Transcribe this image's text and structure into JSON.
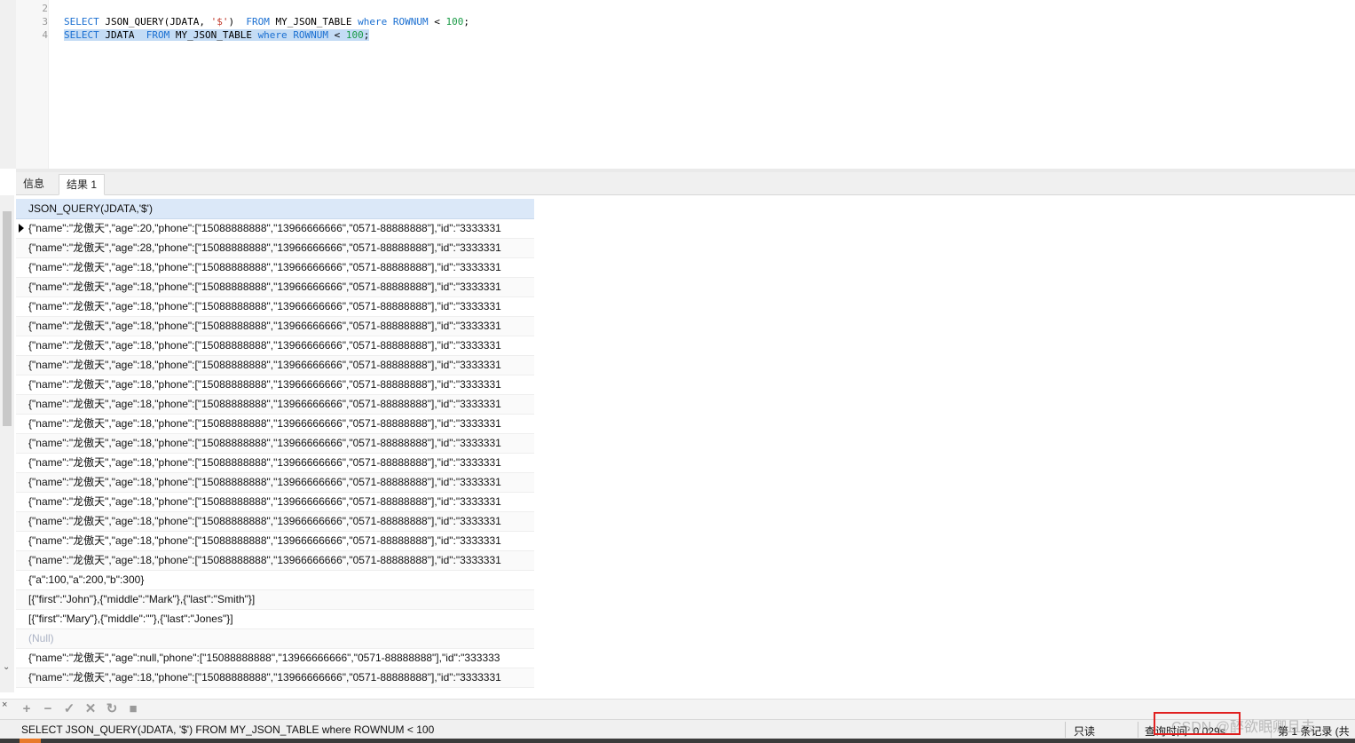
{
  "editor": {
    "lines": [
      {
        "num": "2"
      },
      {
        "num": "3",
        "tokens": [
          {
            "t": "kw",
            "v": "SELECT "
          },
          {
            "t": "plain",
            "v": "JSON_QUERY(JDATA, "
          },
          {
            "t": "str",
            "v": "'$'"
          },
          {
            "t": "plain",
            "v": ")  "
          },
          {
            "t": "kw",
            "v": "FROM "
          },
          {
            "t": "plain",
            "v": "MY_JSON_TABLE "
          },
          {
            "t": "kw",
            "v": "where "
          },
          {
            "t": "kw",
            "v": "ROWNUM "
          },
          {
            "t": "plain",
            "v": "< "
          },
          {
            "t": "num",
            "v": "100"
          },
          {
            "t": "plain",
            "v": ";"
          }
        ]
      },
      {
        "num": "4",
        "selected": true,
        "tokens": [
          {
            "t": "kw",
            "v": "SELECT "
          },
          {
            "t": "plain",
            "v": "JDATA  "
          },
          {
            "t": "kw",
            "v": "FROM "
          },
          {
            "t": "plain",
            "v": "MY_JSON_TABLE "
          },
          {
            "t": "kw",
            "v": "where "
          },
          {
            "t": "kw",
            "v": "ROWNUM "
          },
          {
            "t": "plain",
            "v": "< "
          },
          {
            "t": "num",
            "v": "100"
          },
          {
            "t": "plain",
            "v": ";"
          }
        ]
      }
    ]
  },
  "tabs": {
    "info": "信息",
    "result": "结果 1"
  },
  "grid": {
    "column": "JSON_QUERY(JDATA,'$')",
    "rows": [
      "{\"name\":\"龙傲天\",\"age\":20,\"phone\":[\"15088888888\",\"13966666666\",\"0571-88888888\"],\"id\":\"3333331",
      "{\"name\":\"龙傲天\",\"age\":28,\"phone\":[\"15088888888\",\"13966666666\",\"0571-88888888\"],\"id\":\"3333331",
      "{\"name\":\"龙傲天\",\"age\":18,\"phone\":[\"15088888888\",\"13966666666\",\"0571-88888888\"],\"id\":\"3333331",
      "{\"name\":\"龙傲天\",\"age\":18,\"phone\":[\"15088888888\",\"13966666666\",\"0571-88888888\"],\"id\":\"3333331",
      "{\"name\":\"龙傲天\",\"age\":18,\"phone\":[\"15088888888\",\"13966666666\",\"0571-88888888\"],\"id\":\"3333331",
      "{\"name\":\"龙傲天\",\"age\":18,\"phone\":[\"15088888888\",\"13966666666\",\"0571-88888888\"],\"id\":\"3333331",
      "{\"name\":\"龙傲天\",\"age\":18,\"phone\":[\"15088888888\",\"13966666666\",\"0571-88888888\"],\"id\":\"3333331",
      "{\"name\":\"龙傲天\",\"age\":18,\"phone\":[\"15088888888\",\"13966666666\",\"0571-88888888\"],\"id\":\"3333331",
      "{\"name\":\"龙傲天\",\"age\":18,\"phone\":[\"15088888888\",\"13966666666\",\"0571-88888888\"],\"id\":\"3333331",
      "{\"name\":\"龙傲天\",\"age\":18,\"phone\":[\"15088888888\",\"13966666666\",\"0571-88888888\"],\"id\":\"3333331",
      "{\"name\":\"龙傲天\",\"age\":18,\"phone\":[\"15088888888\",\"13966666666\",\"0571-88888888\"],\"id\":\"3333331",
      "{\"name\":\"龙傲天\",\"age\":18,\"phone\":[\"15088888888\",\"13966666666\",\"0571-88888888\"],\"id\":\"3333331",
      "{\"name\":\"龙傲天\",\"age\":18,\"phone\":[\"15088888888\",\"13966666666\",\"0571-88888888\"],\"id\":\"3333331",
      "{\"name\":\"龙傲天\",\"age\":18,\"phone\":[\"15088888888\",\"13966666666\",\"0571-88888888\"],\"id\":\"3333331",
      "{\"name\":\"龙傲天\",\"age\":18,\"phone\":[\"15088888888\",\"13966666666\",\"0571-88888888\"],\"id\":\"3333331",
      "{\"name\":\"龙傲天\",\"age\":18,\"phone\":[\"15088888888\",\"13966666666\",\"0571-88888888\"],\"id\":\"3333331",
      "{\"name\":\"龙傲天\",\"age\":18,\"phone\":[\"15088888888\",\"13966666666\",\"0571-88888888\"],\"id\":\"3333331",
      "{\"name\":\"龙傲天\",\"age\":18,\"phone\":[\"15088888888\",\"13966666666\",\"0571-88888888\"],\"id\":\"3333331",
      "{\"a\":100,\"a\":200,\"b\":300}",
      "[{\"first\":\"John\"},{\"middle\":\"Mark\"},{\"last\":\"Smith\"}]",
      "[{\"first\":\"Mary\"},{\"middle\":\"\"},{\"last\":\"Jones\"}]",
      "(Null)",
      "{\"name\":\"龙傲天\",\"age\":null,\"phone\":[\"15088888888\",\"13966666666\",\"0571-88888888\"],\"id\":\"333333",
      "{\"name\":\"龙傲天\",\"age\":18,\"phone\":[\"15088888888\",\"13966666666\",\"0571-88888888\"],\"id\":\"3333331"
    ],
    "selected_row": 0,
    "null_value": "(Null)"
  },
  "toolbar": {
    "buttons": [
      {
        "name": "add-row-button",
        "glyph": "+"
      },
      {
        "name": "delete-row-button",
        "glyph": "−"
      },
      {
        "name": "apply-button",
        "glyph": "✓"
      },
      {
        "name": "discard-button",
        "glyph": "✕"
      },
      {
        "name": "refresh-button",
        "glyph": "↻"
      },
      {
        "name": "stop-button",
        "glyph": "■"
      }
    ]
  },
  "status": {
    "sql": "SELECT JSON_QUERY(JDATA, '$')  FROM MY_JSON_TABLE where ROWNUM < 100",
    "readonly": "只读",
    "query_time": "查询时间: 0.029s",
    "record": "第 1 条记录 (共",
    "watermark": "CSDN @醉欲眠卿且去"
  }
}
